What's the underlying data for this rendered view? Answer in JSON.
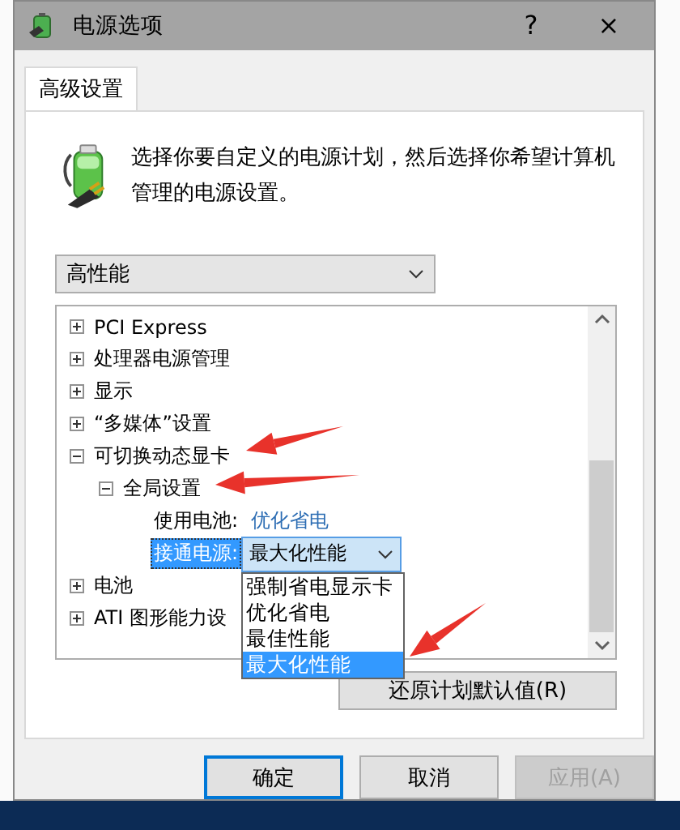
{
  "window": {
    "title": "电源选项",
    "help": "?",
    "close": "×"
  },
  "tabs": [
    {
      "label": "高级设置",
      "selected": true
    }
  ],
  "description": "选择你要自定义的电源计划，然后选择你希望计算机管理的电源设置。",
  "plan_dropdown": {
    "value": "高性能"
  },
  "tree": [
    {
      "label": "PCI Express",
      "expanded": false
    },
    {
      "label": "处理器电源管理",
      "expanded": false
    },
    {
      "label": "显示",
      "expanded": false
    },
    {
      "label": "“多媒体”设置",
      "expanded": false
    },
    {
      "label": "可切换动态显卡",
      "expanded": true,
      "children": [
        {
          "label": "全局设置",
          "expanded": true,
          "children": [
            {
              "kind": "setting",
              "label": "使用电池:",
              "value": "优化省电",
              "selected": false
            },
            {
              "kind": "choice",
              "label": "接通电源:",
              "value": "最大化性能",
              "selected": true,
              "open": true,
              "options": [
                {
                  "label": "强制省电显示卡",
                  "selected": false
                },
                {
                  "label": "优化省电",
                  "selected": false
                },
                {
                  "label": "最佳性能",
                  "selected": false
                },
                {
                  "label": "最大化性能",
                  "selected": true
                }
              ]
            }
          ]
        }
      ]
    },
    {
      "label": "电池",
      "expanded": false
    },
    {
      "label": "ATI 图形能力设",
      "expanded": false
    }
  ],
  "restore_button": "还原计划默认值(R)",
  "buttons": [
    {
      "label": "确定",
      "default": true,
      "disabled": false
    },
    {
      "label": "取消",
      "default": false,
      "disabled": false
    },
    {
      "label": "应用(A)",
      "default": false,
      "disabled": true
    }
  ]
}
